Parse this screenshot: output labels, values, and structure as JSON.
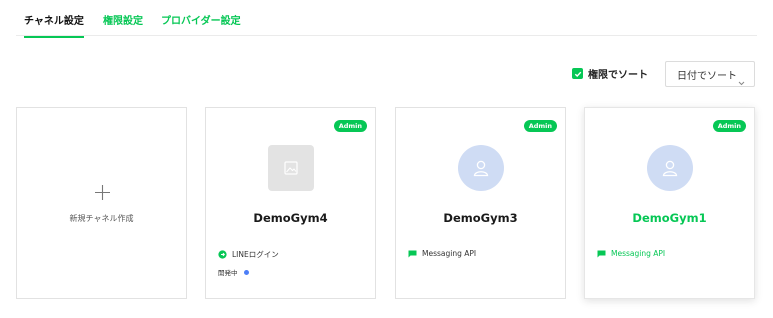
{
  "tabs": [
    {
      "label": "チャネル設定",
      "active": true
    },
    {
      "label": "権限設定",
      "active": false
    },
    {
      "label": "プロバイダー設定",
      "active": false
    }
  ],
  "controls": {
    "permission_sort_label": "権限でソート",
    "permission_sort_checked": true,
    "date_sort_label": "日付でソート"
  },
  "new_channel": {
    "label": "新規チャネル作成"
  },
  "channels": [
    {
      "name": "DemoGym4",
      "badge": "Admin",
      "icon": "image-placeholder-icon",
      "feature": "LINEログイン",
      "feature_icon": "line-login-icon",
      "status": "開発中"
    },
    {
      "name": "DemoGym3",
      "badge": "Admin",
      "icon": "person-icon",
      "feature": "Messaging API",
      "feature_icon": "messaging-api-icon"
    },
    {
      "name": "DemoGym1",
      "badge": "Admin",
      "icon": "person-icon",
      "feature": "Messaging API",
      "feature_icon": "messaging-api-icon"
    }
  ],
  "colors": {
    "accent": "#06c755",
    "avatar_bg": "#cfdcf4",
    "status_dot": "#4d7ef7"
  }
}
